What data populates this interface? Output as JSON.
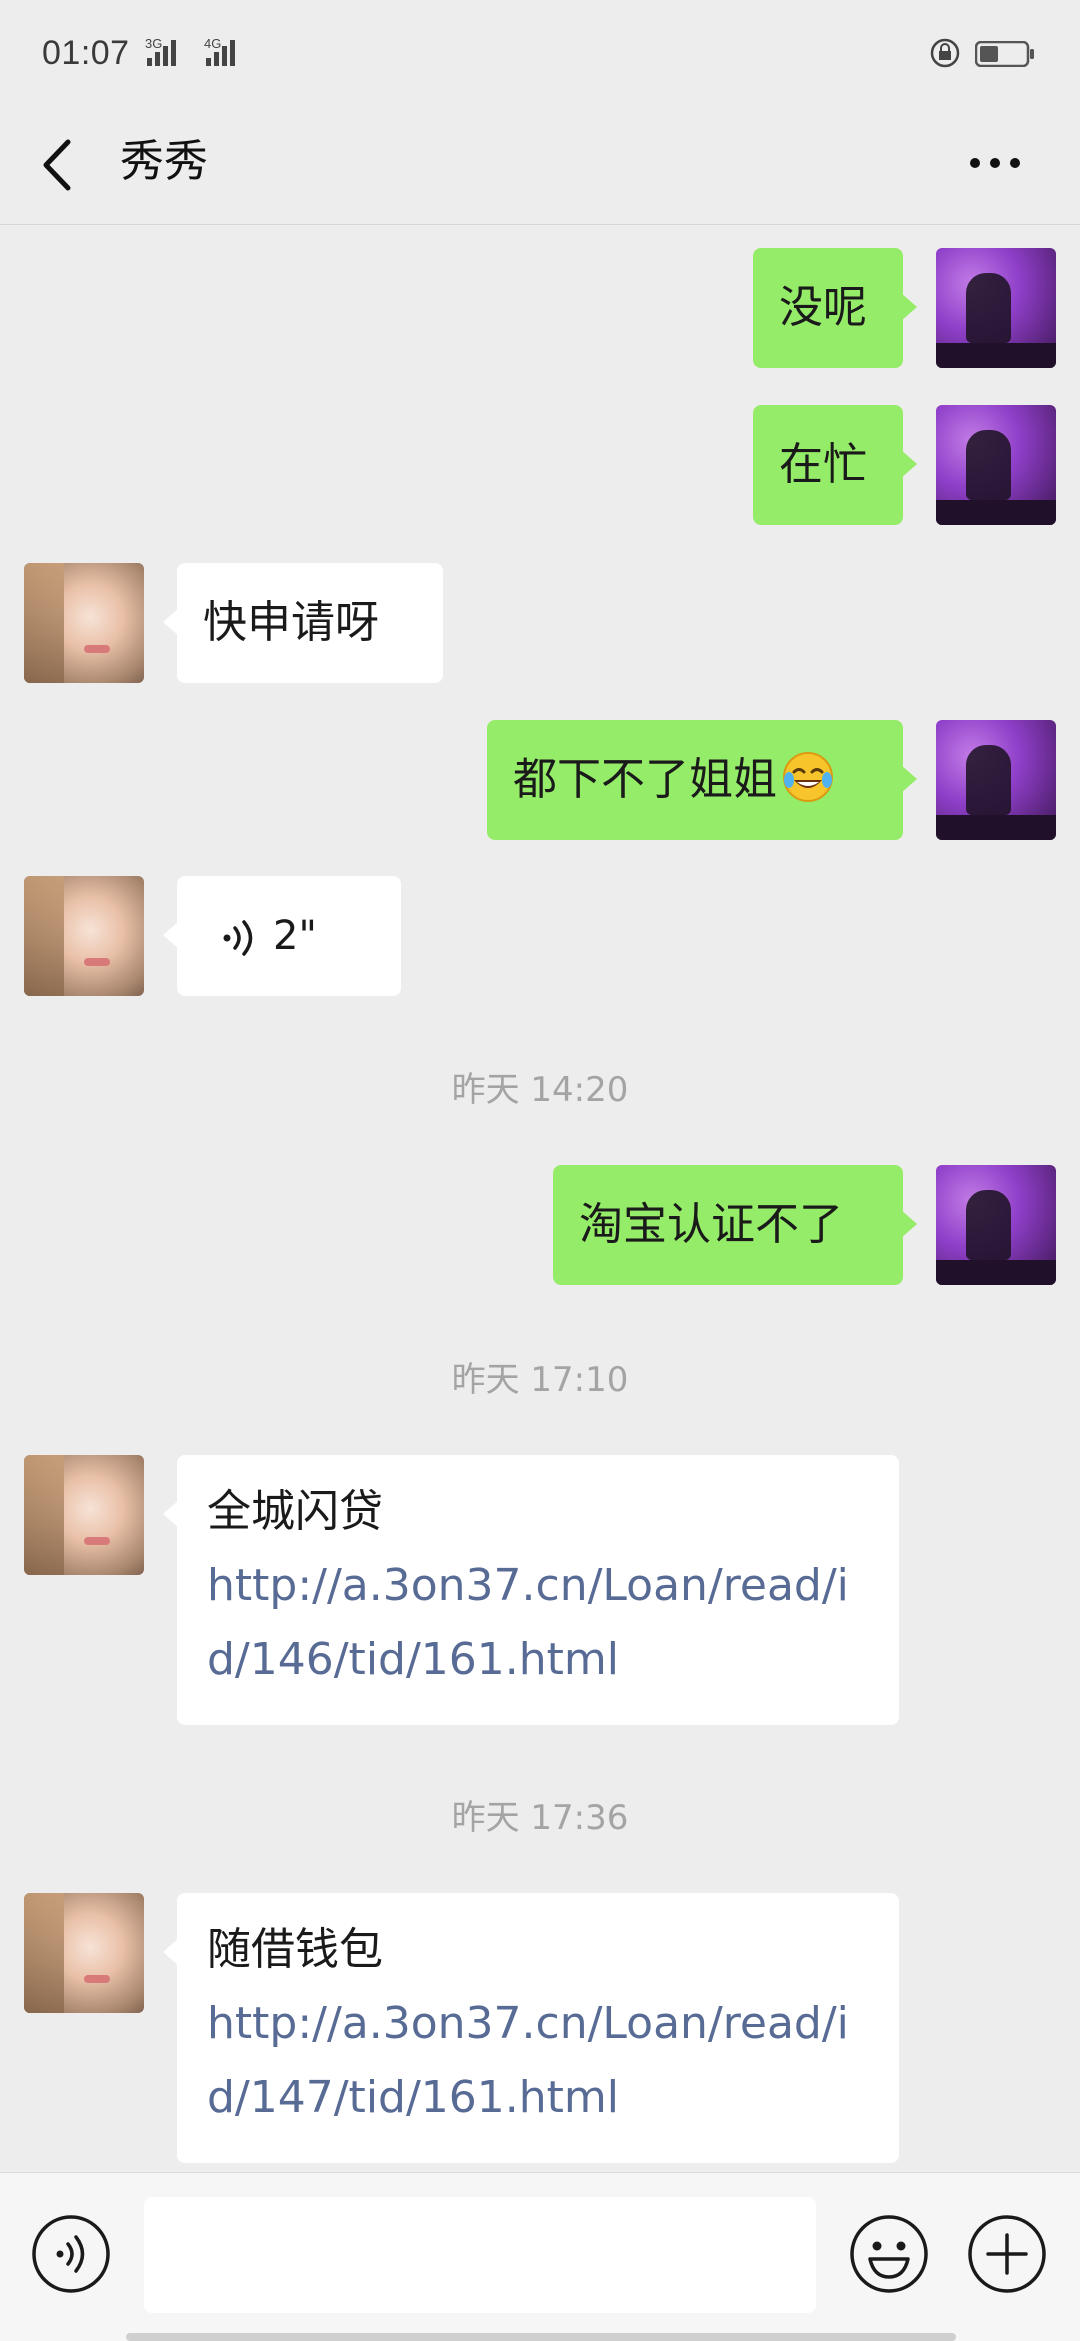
{
  "status_bar": {
    "time": "01:07",
    "network_1": "3G",
    "network_2": "4G"
  },
  "header": {
    "title": "秀秀"
  },
  "messages": [
    {
      "from": "me",
      "text": "没呢"
    },
    {
      "from": "me",
      "text": "在忙"
    },
    {
      "from": "her",
      "text": "快申请呀"
    },
    {
      "from": "me",
      "text": "都下不了姐姐",
      "emoji": "tears-of-joy-emoji"
    },
    {
      "from": "her",
      "type": "voice",
      "duration": "2\""
    },
    {
      "type": "timestamp",
      "text": "昨天 14:20"
    },
    {
      "from": "me",
      "text": "淘宝认证不了"
    },
    {
      "type": "timestamp",
      "text": "昨天 17:10"
    },
    {
      "from": "her",
      "type": "link",
      "title": "全城闪贷",
      "url": "http://a.3on37.cn/Loan/read/id/146/tid/161.html"
    },
    {
      "type": "timestamp",
      "text": "昨天 17:36"
    },
    {
      "from": "her",
      "type": "link",
      "title": "随借钱包",
      "url": "http://a.3on37.cn/Loan/read/id/147/tid/161.html"
    }
  ],
  "input": {
    "placeholder": ""
  },
  "colors": {
    "background": "#ededed",
    "my_bubble": "#95ec69",
    "her_bubble": "#ffffff",
    "link": "#576b95",
    "timestamp": "#a4a4a4"
  },
  "icons": [
    "back-arrow-icon",
    "more-dots-icon",
    "voice-icon",
    "emoji-face-icon",
    "plus-circle-icon",
    "lock-icon",
    "battery-icon",
    "signal-icon"
  ]
}
